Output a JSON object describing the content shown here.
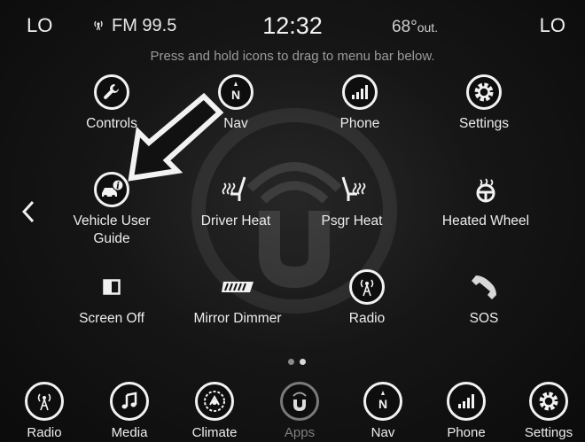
{
  "status": {
    "left_climate": "LO",
    "right_climate": "LO",
    "radio_station": "FM 99.5",
    "clock": "12:32",
    "outside_temp": "68°",
    "outside_temp_unit": "out."
  },
  "hint": "Press and hold icons to drag to menu bar below.",
  "apps": [
    {
      "label": "Controls",
      "icon": "wrench-icon"
    },
    {
      "label": "Nav",
      "icon": "compass-icon"
    },
    {
      "label": "Phone",
      "icon": "phone-signal-icon"
    },
    {
      "label": "Settings",
      "icon": "gear-icon"
    },
    {
      "label": "Vehicle User Guide",
      "label_line1": "Vehicle User",
      "label_line2": "Guide",
      "icon": "user-guide-icon"
    },
    {
      "label": "Driver Heat",
      "icon": "seat-heat-icon"
    },
    {
      "label": "Psgr Heat",
      "icon": "seat-heat-icon"
    },
    {
      "label": "Heated Wheel",
      "icon": "heated-wheel-icon"
    },
    {
      "label": "Screen Off",
      "icon": "screen-off-icon"
    },
    {
      "label": "Mirror Dimmer",
      "icon": "mirror-icon"
    },
    {
      "label": "Radio",
      "icon": "antenna-icon"
    },
    {
      "label": "SOS",
      "icon": "handset-icon"
    }
  ],
  "pager": {
    "pages": 2,
    "current": 1
  },
  "bottom_bar": [
    {
      "label": "Radio",
      "icon": "antenna-icon"
    },
    {
      "label": "Media",
      "icon": "music-note-icon"
    },
    {
      "label": "Climate",
      "icon": "climate-icon"
    },
    {
      "label": "Apps",
      "icon": "uconnect-icon",
      "active": true
    },
    {
      "label": "Nav",
      "icon": "compass-icon"
    },
    {
      "label": "Phone",
      "icon": "phone-signal-icon"
    },
    {
      "label": "Settings",
      "icon": "gear-icon"
    }
  ],
  "colors": {
    "foreground": "#f2f2f2",
    "dimmed": "#7f7f7f",
    "background": "#0b0b0b"
  }
}
